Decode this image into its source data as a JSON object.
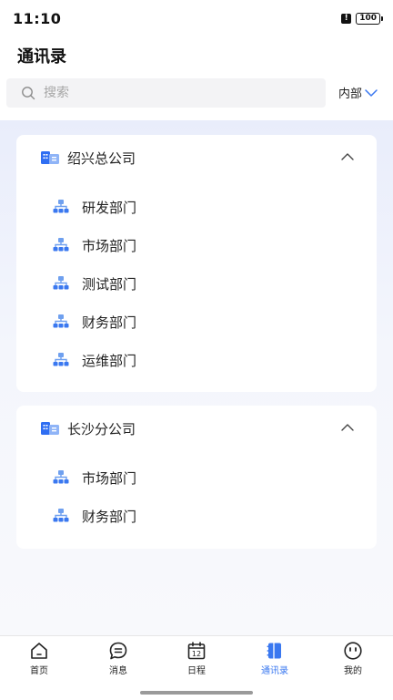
{
  "status_bar": {
    "time": "11:10",
    "battery": "100"
  },
  "header": {
    "title": "通讯录"
  },
  "search": {
    "placeholder": "搜索",
    "value": ""
  },
  "scope": {
    "label": "内部"
  },
  "companies": [
    {
      "name": "绍兴总公司",
      "expanded": true,
      "departments": [
        "研发部门",
        "市场部门",
        "测试部门",
        "财务部门",
        "运维部门"
      ]
    },
    {
      "name": "长沙分公司",
      "expanded": true,
      "departments": [
        "市场部门",
        "财务部门"
      ]
    }
  ],
  "tab_bar": {
    "items": [
      {
        "label": "首页",
        "icon": "home-icon"
      },
      {
        "label": "消息",
        "icon": "message-icon"
      },
      {
        "label": "日程",
        "icon": "calendar-icon",
        "badge": "12"
      },
      {
        "label": "通讯录",
        "icon": "contacts-icon",
        "active": true
      },
      {
        "label": "我的",
        "icon": "profile-icon"
      }
    ]
  },
  "colors": {
    "accent": "#3a78f0",
    "company_icon": "#2f6ef2",
    "dept_icon": "#6fa0ef"
  }
}
